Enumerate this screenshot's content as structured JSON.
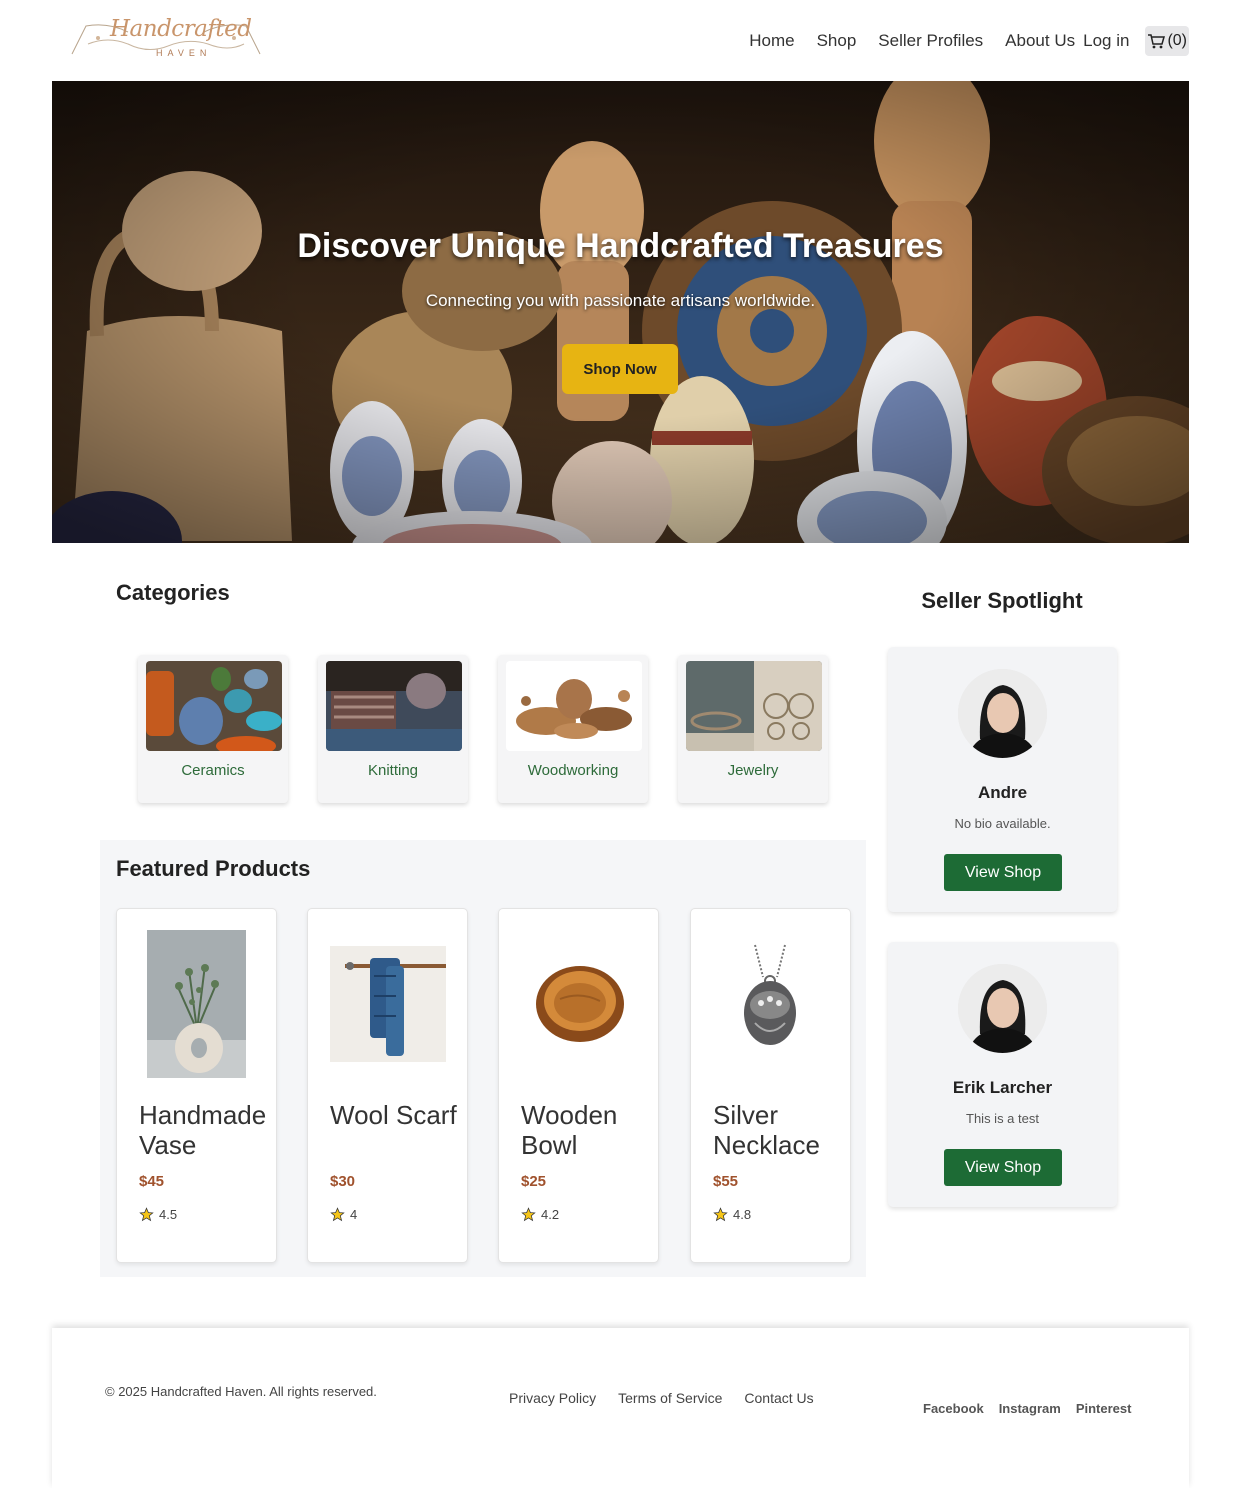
{
  "header": {
    "logo_text": "Handcrafted",
    "logo_sub": "HAVEN",
    "nav": [
      "Home",
      "Shop",
      "Seller Profiles",
      "About Us"
    ],
    "login": "Log in",
    "cart_count": "(0)"
  },
  "hero": {
    "title": "Discover Unique Handcrafted Treasures",
    "subtitle": "Connecting you with passionate artisans worldwide.",
    "button": "Shop Now"
  },
  "categories": {
    "title": "Categories",
    "items": [
      "Ceramics",
      "Knitting",
      "Woodworking",
      "Jewelry"
    ]
  },
  "featured": {
    "title": "Featured Products",
    "products": [
      {
        "name": "Handmade Vase",
        "price": "$45",
        "rating": "4.5"
      },
      {
        "name": "Wool Scarf",
        "price": "$30",
        "rating": "4"
      },
      {
        "name": "Wooden Bowl",
        "price": "$25",
        "rating": "4.2"
      },
      {
        "name": "Silver Necklace",
        "price": "$55",
        "rating": "4.8"
      }
    ]
  },
  "spotlight": {
    "title": "Seller Spotlight",
    "sellers": [
      {
        "name": "Andre",
        "bio": "No bio available.",
        "button": "View Shop"
      },
      {
        "name": "Erik Larcher",
        "bio": "This is a test",
        "button": "View Shop"
      }
    ]
  },
  "footer": {
    "copyright": "© 2025 Handcrafted Haven. All rights reserved.",
    "links": [
      "Privacy Policy",
      "Terms of Service",
      "Contact Us"
    ],
    "social": [
      "Facebook",
      "Instagram",
      "Pinterest"
    ]
  },
  "colors": {
    "accent_green": "#1d6b35",
    "hero_button": "#e7b412",
    "price": "#a0522d"
  }
}
